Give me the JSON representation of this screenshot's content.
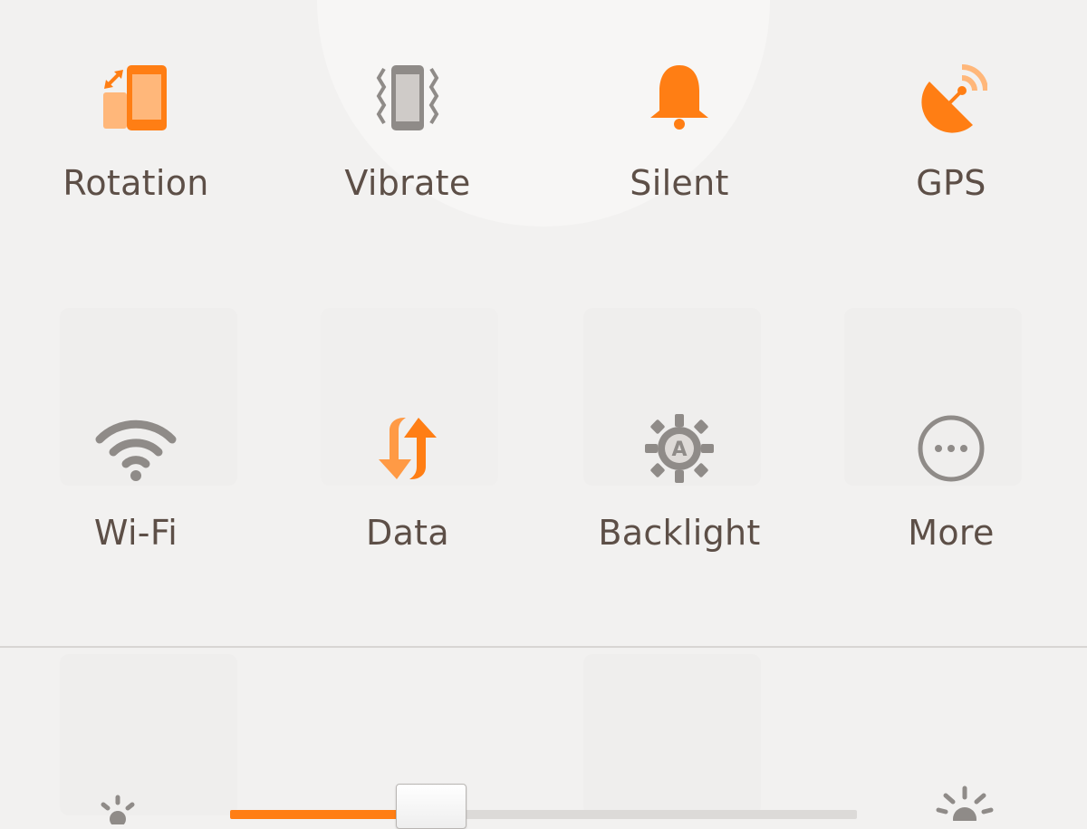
{
  "colors": {
    "accent": "#ff7e14",
    "accent_light": "#ffb77a",
    "inactive_icon": "#8f8b88",
    "label": "#5d4f47",
    "background": "#f2f1f0"
  },
  "toggles_row1": [
    {
      "label": "Rotation",
      "icon": "rotation-icon",
      "active": true
    },
    {
      "label": "Vibrate",
      "icon": "vibrate-icon",
      "active": false
    },
    {
      "label": "Silent",
      "icon": "bell-icon",
      "active": true
    },
    {
      "label": "GPS",
      "icon": "gps-icon",
      "active": true
    }
  ],
  "toggles_row2": [
    {
      "label": "Wi-Fi",
      "icon": "wifi-icon",
      "active": false
    },
    {
      "label": "Data",
      "icon": "data-sync-icon",
      "active": true
    },
    {
      "label": "Backlight",
      "icon": "auto-brightness-icon",
      "active": false
    },
    {
      "label": "More",
      "icon": "more-icon",
      "active": false
    }
  ],
  "brightness": {
    "level": 0.32,
    "low_icon": "brightness-low-icon",
    "high_icon": "brightness-high-icon"
  }
}
